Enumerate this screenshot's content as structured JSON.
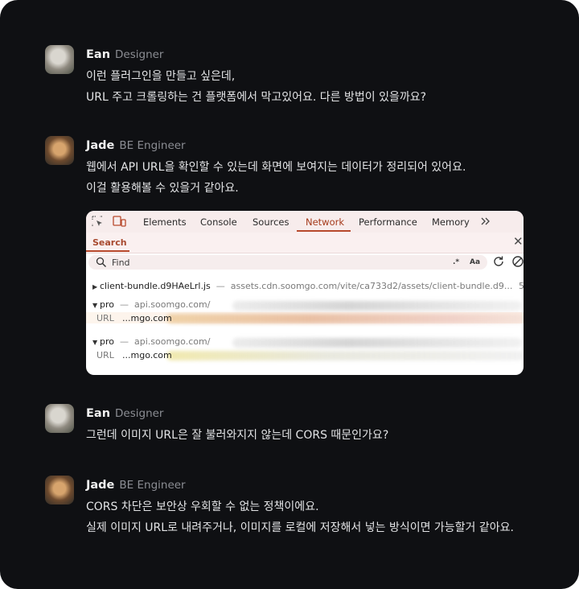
{
  "messages": [
    {
      "name": "Ean",
      "role": "Designer",
      "lines": [
        "이런 플러그인을 만들고 싶은데,",
        "URL 주고 크롤링하는 건 플랫폼에서 막고있어요. 다른 방법이 있을까요?"
      ]
    },
    {
      "name": "Jade",
      "role": "BE Engineer",
      "lines": [
        "웹에서 API URL을 확인할 수 있는데 화면에 보여지는 데이터가 정리되어 있어요.",
        "이걸 활용해볼 수 있을거 같아요."
      ]
    },
    {
      "name": "Ean",
      "role": "Designer",
      "lines": [
        "그런데 이미지 URL은 잘 불러와지지 않는데 CORS 때문인가요?"
      ]
    },
    {
      "name": "Jade",
      "role": "BE Engineer",
      "lines": [
        "CORS 차단은 보안상 우회할 수 없는 정책이에요.",
        "실제 이미지 URL로 내려주거나, 이미지를 로컬에 저장해서 넣는 방식이면 가능할거 같아요."
      ]
    }
  ],
  "devtools": {
    "tabs": [
      "Elements",
      "Console",
      "Sources",
      "Network",
      "Performance",
      "Memory"
    ],
    "active_tab": "Network",
    "more_icon": "chevron-double-right-icon",
    "search_label": "Search",
    "find_placeholder": "Find",
    "regex_label": ".*",
    "case_label": "Aa",
    "results": {
      "file": "client-bundle.d9HAeLrl.js",
      "sep": "—",
      "url": "assets.cdn.soomgo.com/vite/ca733d2/assets/client-bundle.d9...",
      "count": "5",
      "groups": [
        {
          "method": "pro",
          "host": "api.soomgo.com/",
          "url_key": "URL",
          "url_value": "...mgo.com"
        },
        {
          "method": "pro",
          "host": "api.soomgo.com/",
          "url_key": "URL",
          "url_value": "...mgo.com"
        }
      ]
    }
  },
  "colors": {
    "background": "#0f1013",
    "accent": "#b84a2d"
  }
}
